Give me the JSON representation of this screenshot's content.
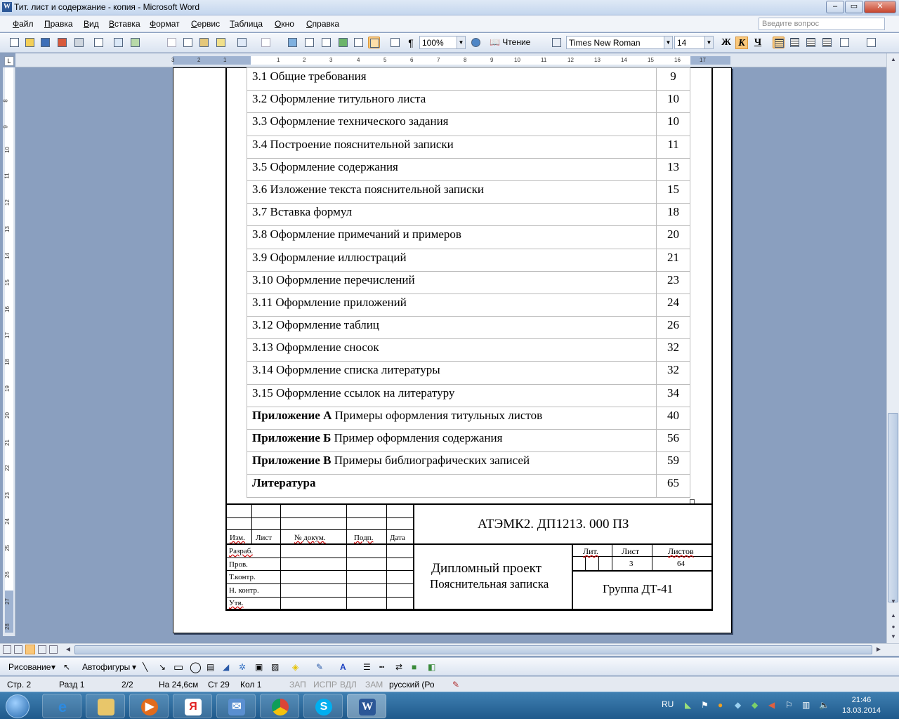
{
  "window": {
    "title": "Тит. лист и содержание - копия - Microsoft Word",
    "min": "–",
    "max": "▭",
    "close": "✕"
  },
  "menu": {
    "items": [
      "Файл",
      "Правка",
      "Вид",
      "Вставка",
      "Формат",
      "Сервис",
      "Таблица",
      "Окно",
      "Справка"
    ],
    "ask_placeholder": "Введите вопрос"
  },
  "toolbar": {
    "zoom": "100%",
    "reading": "Чтение",
    "font": "Times New Roman",
    "size": "14",
    "bold": "Ж",
    "italic": "К",
    "underline": "Ч",
    "pilcrow": "¶"
  },
  "ruler": {
    "h": [
      "3",
      "2",
      "1",
      "1",
      "2",
      "3",
      "4",
      "5",
      "6",
      "7",
      "8",
      "9",
      "10",
      "11",
      "12",
      "13",
      "14",
      "15",
      "16",
      "17"
    ],
    "v": [
      "8",
      "9",
      "10",
      "11",
      "12",
      "13",
      "14",
      "15",
      "16",
      "17",
      "18",
      "19",
      "20",
      "21",
      "22",
      "23",
      "24",
      "25",
      "26",
      "27",
      "28"
    ]
  },
  "toc": [
    {
      "text": "3.1 Общие требования",
      "page": "9"
    },
    {
      "text": "3.2 Оформление титульного листа",
      "page": "10"
    },
    {
      "text": "3.3 Оформление технического задания",
      "page": "10"
    },
    {
      "text": "3.4 Построение пояснительной записки",
      "page": "11"
    },
    {
      "text": "3.5 Оформление содержания",
      "page": "13"
    },
    {
      "text": "3.6 Изложение текста пояснительной записки",
      "page": "15"
    },
    {
      "text": "3.7 Вставка формул",
      "page": "18"
    },
    {
      "text": "3.8 Оформление примечаний и примеров",
      "page": "20"
    },
    {
      "text": "3.9 Оформление иллюстраций",
      "page": "21"
    },
    {
      "text": "3.10 Оформление перечислений",
      "page": "23"
    },
    {
      "text": "3.11 Оформление приложений",
      "page": "24"
    },
    {
      "text": "3.12 Оформление таблиц",
      "page": "26"
    },
    {
      "text": "3.13 Оформление сносок",
      "page": "32"
    },
    {
      "text": "3.14 Оформление списка литературы",
      "page": "32"
    },
    {
      "text": "3.15 Оформление ссылок на литературу",
      "page": "34"
    },
    {
      "bold": "Приложение А",
      "text": " Примеры оформления титульных листов",
      "page": "40"
    },
    {
      "bold": "Приложение Б",
      "text": " Пример оформления содержания",
      "page": "56"
    },
    {
      "bold": "Приложение В",
      "text": " Примеры библиографических записей",
      "page": "59"
    },
    {
      "bold": "Литература",
      "text": "",
      "page": "65"
    }
  ],
  "stamp": {
    "code": "АТЭМК2. ДП1213. 000 ПЗ",
    "izm": "Изм.",
    "list": "Лист",
    "ndoc": "№ докум.",
    "podp": "Подп.",
    "date": "Дата",
    "razrab": "Разраб.",
    "prov": "Пров.",
    "tkontr": "Т.контр.",
    "nkontr": "Н. контр.",
    "utv": "Утв.",
    "title1": "Дипломный проект",
    "title2": "Пояснительная записка",
    "lit": "Лит.",
    "sheet": "Лист",
    "sheets": "Листов",
    "sheet_val": "3",
    "sheets_val": "64",
    "group": "Группа ДТ-41"
  },
  "drawing": {
    "draw": "Рисование",
    "autoshapes": "Автофигуры"
  },
  "status": {
    "page": "Стр. 2",
    "section": "Разд 1",
    "pages": "2/2",
    "at": "На 24,6см",
    "line": "Ст 29",
    "col": "Кол 1",
    "rec": "ЗАП",
    "trk": "ИСПР",
    "ext": "ВДЛ",
    "ovr": "ЗАМ",
    "lang": "русский (Ро"
  },
  "taskbar": {
    "lang": "RU",
    "time": "21:46",
    "date": "13.03.2014",
    "apps": [
      "ie-icon",
      "folder-icon",
      "media-icon",
      "yandex-icon",
      "mail-icon",
      "chrome-icon",
      "skype-icon",
      "word-icon"
    ]
  }
}
